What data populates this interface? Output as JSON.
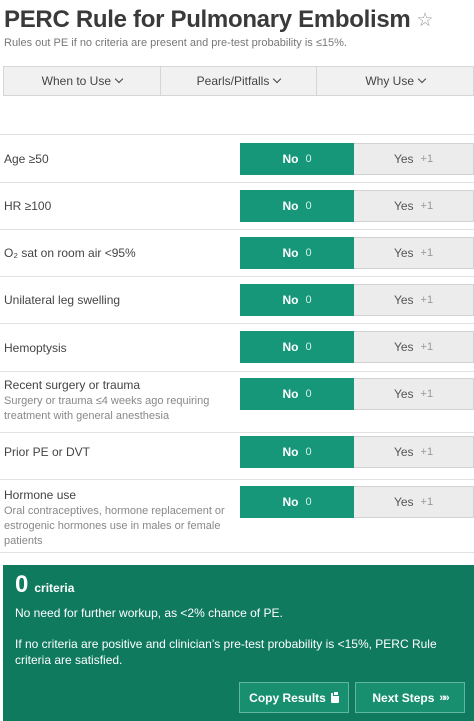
{
  "header": {
    "title": "PERC Rule for Pulmonary Embolism",
    "subtitle": "Rules out PE if no criteria are present and pre-test probability is ≤15%."
  },
  "tabs": [
    {
      "label": "When to Use"
    },
    {
      "label": "Pearls/Pitfalls"
    },
    {
      "label": "Why Use"
    }
  ],
  "criteria": [
    {
      "label": "Age ≥50",
      "sub": "",
      "no_label": "No",
      "no_points": "0",
      "yes_label": "Yes",
      "yes_points": "+1",
      "selected": "No"
    },
    {
      "label": "HR ≥100",
      "sub": "",
      "no_label": "No",
      "no_points": "0",
      "yes_label": "Yes",
      "yes_points": "+1",
      "selected": "No"
    },
    {
      "label": "O₂ sat on room air <95%",
      "sub": "",
      "no_label": "No",
      "no_points": "0",
      "yes_label": "Yes",
      "yes_points": "+1",
      "selected": "No"
    },
    {
      "label": "Unilateral leg swelling",
      "sub": "",
      "no_label": "No",
      "no_points": "0",
      "yes_label": "Yes",
      "yes_points": "+1",
      "selected": "No"
    },
    {
      "label": "Hemoptysis",
      "sub": "",
      "no_label": "No",
      "no_points": "0",
      "yes_label": "Yes",
      "yes_points": "+1",
      "selected": "No"
    },
    {
      "label": "Recent surgery or trauma",
      "sub": "Surgery or trauma ≤4 weeks ago requiring treatment with general anesthesia",
      "no_label": "No",
      "no_points": "0",
      "yes_label": "Yes",
      "yes_points": "+1",
      "selected": "No"
    },
    {
      "label": "Prior PE or DVT",
      "sub": "",
      "no_label": "No",
      "no_points": "0",
      "yes_label": "Yes",
      "yes_points": "+1",
      "selected": "No"
    },
    {
      "label": "Hormone use",
      "sub": "Oral contraceptives, hormone replacement or estrogenic hormones use in males or female patients",
      "no_label": "No",
      "no_points": "0",
      "yes_label": "Yes",
      "yes_points": "+1",
      "selected": "No"
    }
  ],
  "result": {
    "score": "0",
    "unit": "criteria",
    "line1": "No need for further workup, as <2% chance of PE.",
    "line2": "If no criteria are positive and clinician’s pre-test probability is <15%, PERC Rule criteria are satisfied.",
    "copy_label": "Copy Results",
    "next_label": "Next Steps",
    "next_icon": "»»"
  },
  "colors": {
    "selected": "#17977a",
    "result_bg": "#107a5f"
  }
}
